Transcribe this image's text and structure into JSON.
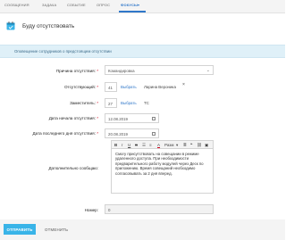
{
  "topnav": {
    "items": [
      "СООБЩЕНИЯ",
      "ЗАДАЧА",
      "СОБЫТИЕ",
      "ОПРОС",
      "ФОКУСЫ",
      "ЕЩЁ"
    ],
    "active_index": 4,
    "dropdown_icon": "chevron-down-icon"
  },
  "header": {
    "title": "Буду отсутствовать",
    "icon": "absence-icon"
  },
  "notice": "Оповещение сотрудников о предстоящем отсутствии",
  "form": {
    "reason": {
      "label": "Причина отсутствия:",
      "value": "Командировка"
    },
    "absent": {
      "label": "Отсутствующий:",
      "id": "41",
      "select_link": "Выбрать",
      "name": "Ларина Вероника"
    },
    "deputy": {
      "label": "Заместитель:",
      "id": "27",
      "select_link": "Выбрать",
      "name": "ТС"
    },
    "start_date": {
      "label": "Дата начала отсутствия:",
      "value": "12.08.2019"
    },
    "end_date": {
      "label": "Дата последнего дня отсутствия:",
      "value": "20.08.2019"
    },
    "message": {
      "label": "Дополнительно сообщаю:",
      "text": "Смогу присутствовать на совещании в режиме удаленного доступа. При необходимости предварительного работу модулей через Деск по приложению. Время совещаний необходимо согласовывать за 2 дня вперед."
    },
    "number": {
      "label": "Номер:",
      "value": "0"
    },
    "required_mark": "*"
  },
  "toolbar": {
    "bold": "B",
    "italic": "I",
    "underline": "U",
    "strike": "S",
    "font_color": "A",
    "font_size": "Разм"
  },
  "footer": {
    "submit_label": "ОТПРАВИТЬ",
    "cancel_label": "ОТМЕНИТЬ"
  },
  "colors": {
    "accent": "#2f77c9",
    "button": "#39b4e8",
    "notice_bg": "#dff0f8"
  }
}
